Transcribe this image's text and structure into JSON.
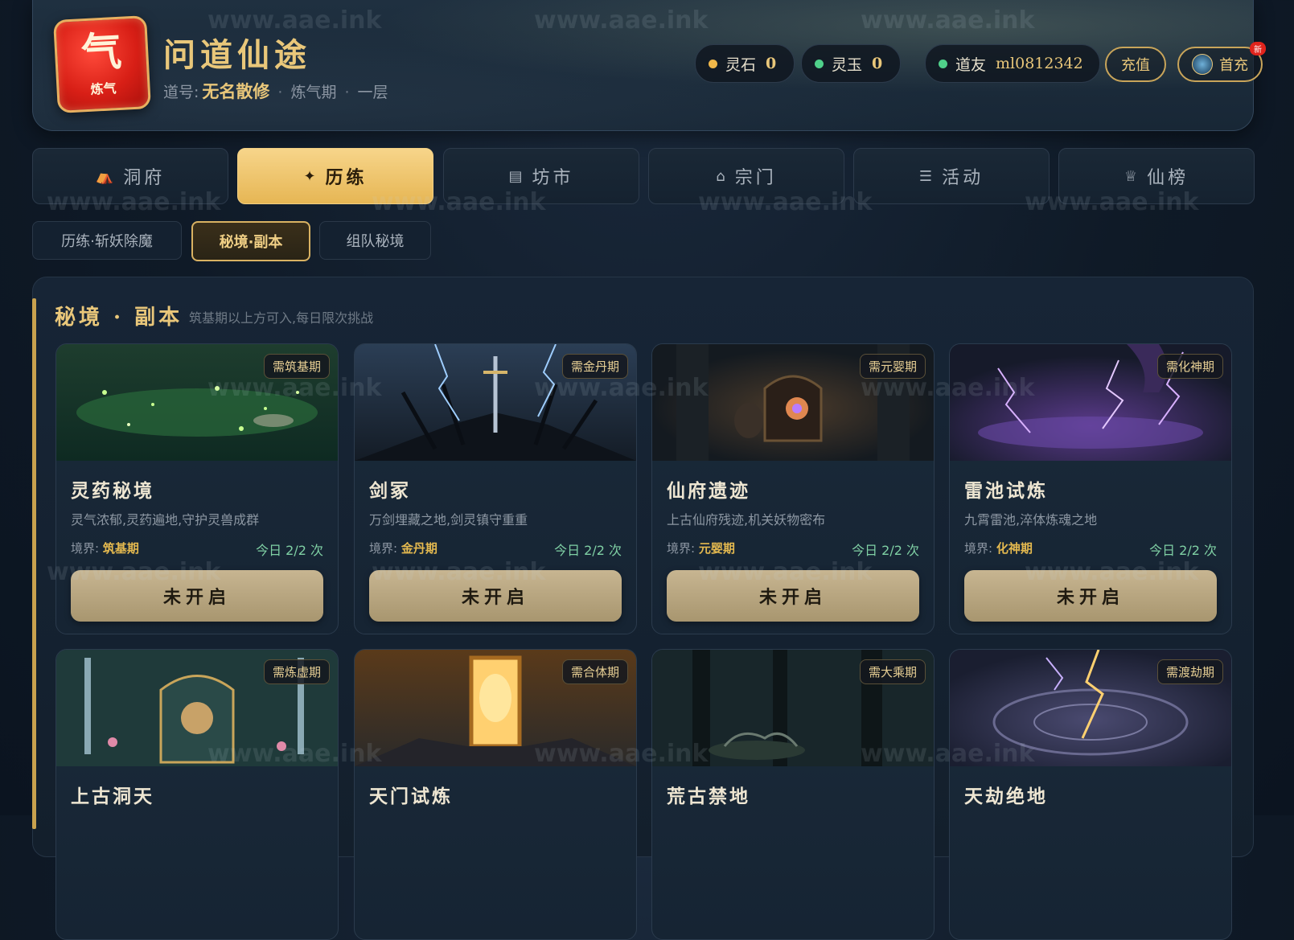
{
  "header": {
    "logo_big": "气",
    "logo_small": "炼气",
    "title": "问道仙途",
    "daohao_label": "道号:",
    "daohao_value": "无名散修",
    "stage": "炼气期",
    "level": "一层",
    "separator": "·"
  },
  "currency": {
    "lingshi_label": "灵石",
    "lingshi_value": "0",
    "lingshi_color": "#f1b84a",
    "lingyu_label": "灵玉",
    "lingyu_value": "0",
    "lingyu_color": "#4fd08a"
  },
  "user": {
    "label": "道友",
    "id": "ml0812342",
    "status_color": "#4fd08a"
  },
  "actions": {
    "recharge": "充值",
    "first_recharge": "首充",
    "first_recharge_badge": "新"
  },
  "nav": [
    {
      "label": "洞府",
      "icon": "cave-icon",
      "glyph": "⛺"
    },
    {
      "label": "历练",
      "icon": "sparkle-icon",
      "glyph": "✦",
      "active": true
    },
    {
      "label": "坊市",
      "icon": "shop-icon",
      "glyph": "▤"
    },
    {
      "label": "宗门",
      "icon": "home-icon",
      "glyph": "⌂"
    },
    {
      "label": "活动",
      "icon": "list-icon",
      "glyph": "☰"
    },
    {
      "label": "仙榜",
      "icon": "trophy-icon",
      "glyph": "♕"
    }
  ],
  "subtabs": [
    {
      "label": "历练·斩妖除魔"
    },
    {
      "label": "秘境·副本",
      "active": true
    },
    {
      "label": "组队秘境"
    }
  ],
  "section": {
    "title": "秘境 · 副本",
    "desc": "筑基期以上方可入,每日限次挑战"
  },
  "card_common": {
    "realm_label": "境界:",
    "button_label": "未开启"
  },
  "dungeons": [
    {
      "name": "灵药秘境",
      "tag": "需筑基期",
      "desc": "灵气浓郁,灵药遍地,守护灵兽成群",
      "realm": "筑基期",
      "times": "今日 2/2 次"
    },
    {
      "name": "剑冢",
      "tag": "需金丹期",
      "desc": "万剑埋藏之地,剑灵镇守重重",
      "realm": "金丹期",
      "times": "今日 2/2 次"
    },
    {
      "name": "仙府遗迹",
      "tag": "需元婴期",
      "desc": "上古仙府残迹,机关妖物密布",
      "realm": "元婴期",
      "times": "今日 2/2 次"
    },
    {
      "name": "雷池试炼",
      "tag": "需化神期",
      "desc": "九霄雷池,淬体炼魂之地",
      "realm": "化神期",
      "times": "今日 2/2 次"
    },
    {
      "name": "上古洞天",
      "tag": "需炼虚期",
      "desc": "",
      "realm": "",
      "times": ""
    },
    {
      "name": "天门试炼",
      "tag": "需合体期",
      "desc": "",
      "realm": "",
      "times": ""
    },
    {
      "name": "荒古禁地",
      "tag": "需大乘期",
      "desc": "",
      "realm": "",
      "times": ""
    },
    {
      "name": "天劫绝地",
      "tag": "需渡劫期",
      "desc": "",
      "realm": "",
      "times": ""
    }
  ],
  "watermark": "www.aae.ink"
}
